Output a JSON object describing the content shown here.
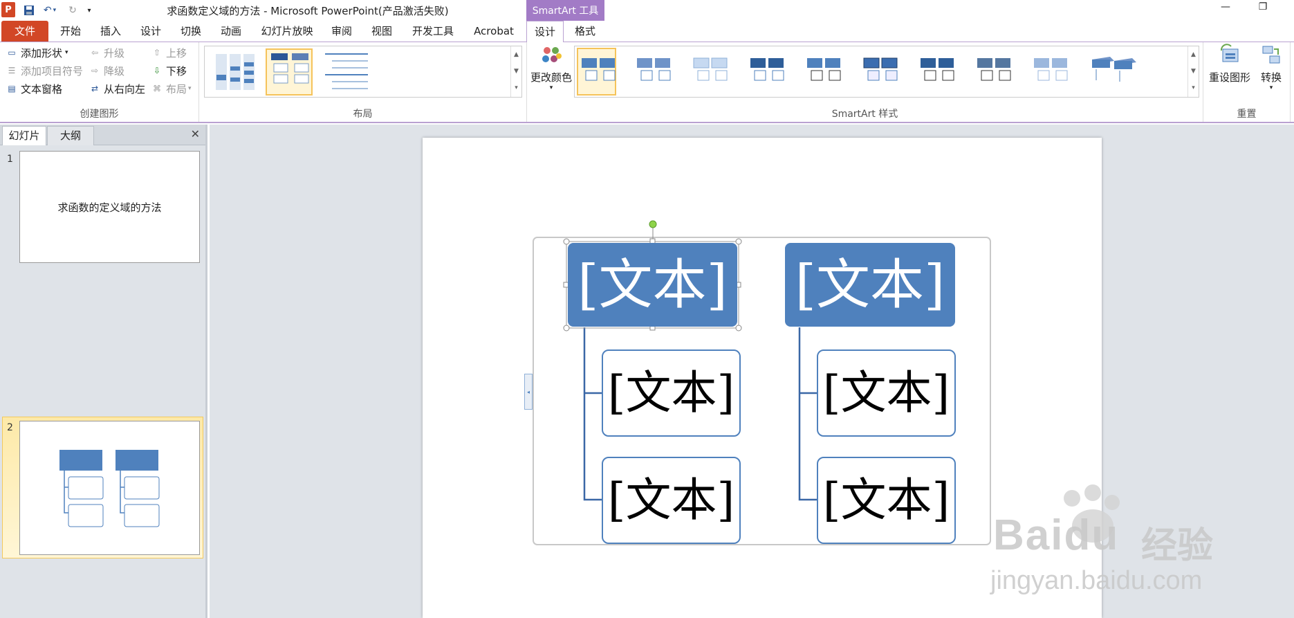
{
  "window": {
    "app_icon": "P",
    "title": "求函数定义域的方法 - Microsoft PowerPoint(产品激活失败)",
    "contextual_tool_label": "SmartArt 工具"
  },
  "quick_access": {
    "icons": [
      "save-icon",
      "undo-icon",
      "redo-icon",
      "customize-icon"
    ]
  },
  "tabs": [
    {
      "label": "文件"
    },
    {
      "label": "开始"
    },
    {
      "label": "插入"
    },
    {
      "label": "设计"
    },
    {
      "label": "切换"
    },
    {
      "label": "动画"
    },
    {
      "label": "幻灯片放映"
    },
    {
      "label": "审阅"
    },
    {
      "label": "视图"
    },
    {
      "label": "开发工具"
    },
    {
      "label": "Acrobat"
    },
    {
      "label": "设计"
    },
    {
      "label": "格式"
    }
  ],
  "ribbon": {
    "create_graphic": {
      "label": "创建图形",
      "add_shape": "添加形状",
      "add_bullet": "添加项目符号",
      "text_pane": "文本窗格",
      "promote": "升级",
      "demote": "降级",
      "right_to_left": "从右向左",
      "move_up": "上移",
      "move_down": "下移",
      "layout": "布局"
    },
    "layouts": {
      "label": "布局"
    },
    "styles": {
      "label": "SmartArt 样式",
      "change_colors": "更改颜色"
    },
    "reset": {
      "label": "重置",
      "reset_graphic": "重设图形",
      "convert": "转换"
    }
  },
  "left_pane": {
    "tab_slides": "幻灯片",
    "tab_outline": "大纲",
    "slides": [
      {
        "number": "1",
        "title": "求函数的定义域的方法"
      },
      {
        "number": "2"
      }
    ]
  },
  "smartart": {
    "placeholder": "[文本]",
    "colors": {
      "parent_fill": "#4f81bd",
      "child_border": "#4f81bd"
    }
  },
  "watermark": {
    "brand": "Baidu",
    "cn": "经验",
    "url": "jingyan.baidu.com"
  }
}
